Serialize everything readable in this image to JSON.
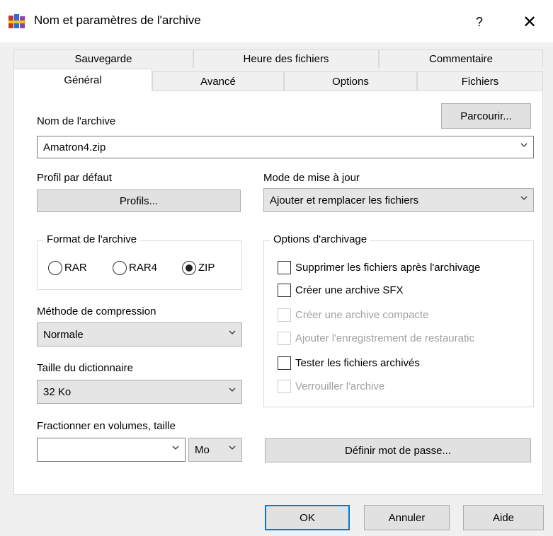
{
  "window": {
    "title": "Nom et paramètres de l'archive",
    "help_label": "?",
    "close_label": "✕"
  },
  "tabs": {
    "row_back": [
      "Sauvegarde",
      "Heure des fichiers",
      "Commentaire"
    ],
    "row_front": [
      "Général",
      "Avancé",
      "Options",
      "Fichiers"
    ],
    "active": "Général"
  },
  "general": {
    "archive_name_label": "Nom de l'archive",
    "browse_label": "Parcourir...",
    "archive_name_value": "Amatron4.zip",
    "default_profile_label": "Profil par défaut",
    "profiles_button": "Profils...",
    "update_mode_label": "Mode de mise à jour",
    "update_mode_value": "Ajouter et remplacer les fichiers",
    "format_group_title": "Format de l'archive",
    "format_options": [
      "RAR",
      "RAR4",
      "ZIP"
    ],
    "format_selected": "ZIP",
    "compression_label": "Méthode de compression",
    "compression_value": "Normale",
    "dictionary_label": "Taille du dictionnaire",
    "dictionary_value": "32 Ko",
    "split_label": "Fractionner en volumes, taille",
    "split_value": "",
    "split_unit": "Mo",
    "archiving_options_title": "Options d'archivage",
    "options": [
      {
        "label": "Supprimer les fichiers après l'archivage",
        "checked": false,
        "enabled": true
      },
      {
        "label": "Créer une archive SFX",
        "checked": false,
        "enabled": true
      },
      {
        "label": "Créer une archive compacte",
        "checked": false,
        "enabled": false
      },
      {
        "label": "Ajouter l'enregistrement de restauratic",
        "checked": false,
        "enabled": false
      },
      {
        "label": "Tester les fichiers archivés",
        "checked": false,
        "enabled": true
      },
      {
        "label": "Verrouiller l'archive",
        "checked": false,
        "enabled": false
      }
    ],
    "password_button": "Définir mot de passe..."
  },
  "footer": {
    "ok_label": "OK",
    "cancel_label": "Annuler",
    "help_label": "Aide"
  },
  "colors": {
    "accent": "#0078d7",
    "panel": "#ffffff",
    "background": "#f0f0f0"
  }
}
